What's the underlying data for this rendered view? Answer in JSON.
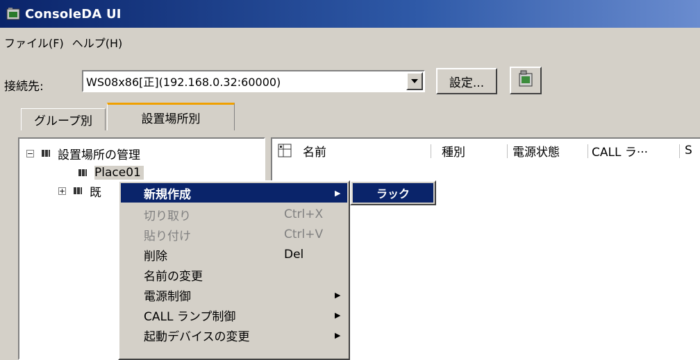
{
  "window": {
    "title": "ConsoleDA UI",
    "titlebar_color": "#0a246a"
  },
  "menubar": {
    "items": [
      "ファイル(F)",
      "ヘルプ(H)"
    ]
  },
  "connection": {
    "label": "接続先:",
    "selected_value": "WS08x86[正](192.168.0.32:60000)",
    "settings_button": "設定...",
    "refresh_icon": "server-refresh-icon"
  },
  "tabs": [
    {
      "label": "グループ別",
      "active": false
    },
    {
      "label": "設置場所別",
      "active": true
    }
  ],
  "tree": {
    "root": {
      "label": "設置場所の管理",
      "expander": "⊟"
    },
    "children": [
      {
        "label": "Place01",
        "selected": true
      },
      {
        "label": "既",
        "expander": "⊞"
      }
    ]
  },
  "list": {
    "columns": [
      "名前",
      "種別",
      "電源状態",
      "CALL ラ···",
      "S"
    ]
  },
  "context_menu": {
    "items": [
      {
        "label": "新規作成",
        "shortcut": "",
        "submenu": true,
        "highlighted": true,
        "disabled": false
      },
      {
        "label": "切り取り",
        "shortcut": "Ctrl+X",
        "submenu": false,
        "highlighted": false,
        "disabled": true
      },
      {
        "label": "貼り付け",
        "shortcut": "Ctrl+V",
        "submenu": false,
        "highlighted": false,
        "disabled": true
      },
      {
        "label": "削除",
        "shortcut": "Del",
        "submenu": false,
        "highlighted": false,
        "disabled": false
      },
      {
        "label": "名前の変更",
        "shortcut": "",
        "submenu": false,
        "highlighted": false,
        "disabled": false
      },
      {
        "label": "電源制御",
        "shortcut": "",
        "submenu": true,
        "highlighted": false,
        "disabled": false
      },
      {
        "label": "CALL ランプ制御",
        "shortcut": "",
        "submenu": true,
        "highlighted": false,
        "disabled": false
      },
      {
        "label": "起動デバイスの変更",
        "shortcut": "",
        "submenu": true,
        "highlighted": false,
        "disabled": false
      }
    ]
  },
  "submenu": {
    "items": [
      "ラック"
    ]
  },
  "colors": {
    "highlight": "#0a246a",
    "face": "#d4d0c8",
    "tab_accent": "#f0a000"
  }
}
